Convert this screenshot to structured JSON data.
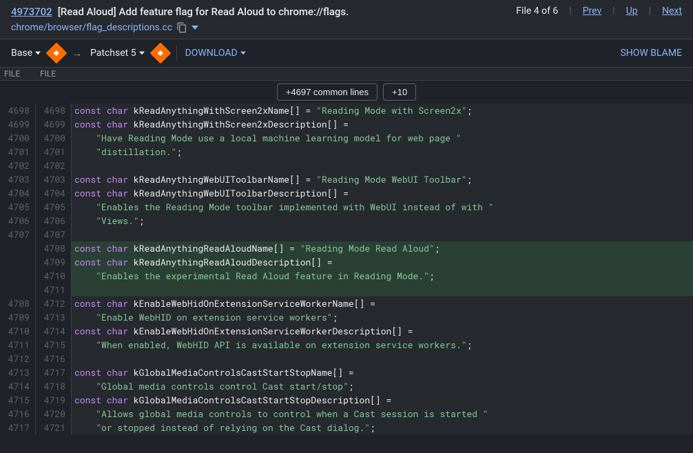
{
  "header": {
    "change_id": "4973702",
    "change_title": "[Read Aloud] Add feature flag for Read Aloud to chrome://flags.",
    "file_path": "chrome/browser/flag_descriptions.cc",
    "file_count": "File 4 of 6",
    "prev": "Prev",
    "up": "Up",
    "next": "Next"
  },
  "toolbar": {
    "base": "Base",
    "patchset": "Patchset 5",
    "download": "DOWNLOAD",
    "blame": "SHOW BLAME"
  },
  "file_headers": {
    "left": "FILE",
    "right": "FILE"
  },
  "context": {
    "common": "+4697 common lines",
    "expand": "+10"
  },
  "lines": [
    {
      "l": "4698",
      "r": "4698",
      "added": false,
      "tokens": [
        {
          "t": "kw",
          "v": "const"
        },
        {
          "t": "sp",
          "v": " "
        },
        {
          "t": "type",
          "v": "char"
        },
        {
          "t": "sp",
          "v": " "
        },
        {
          "t": "ident",
          "v": "kReadAnythingWithScreen2xName[] = "
        },
        {
          "t": "str",
          "v": "\"Reading Mode with Screen2x\""
        },
        {
          "t": "punct",
          "v": ";"
        }
      ]
    },
    {
      "l": "4699",
      "r": "4699",
      "added": false,
      "tokens": [
        {
          "t": "kw",
          "v": "const"
        },
        {
          "t": "sp",
          "v": " "
        },
        {
          "t": "type",
          "v": "char"
        },
        {
          "t": "sp",
          "v": " "
        },
        {
          "t": "ident",
          "v": "kReadAnythingWithScreen2xDescription[] ="
        }
      ]
    },
    {
      "l": "4700",
      "r": "4700",
      "added": false,
      "tokens": [
        {
          "t": "sp",
          "v": "    "
        },
        {
          "t": "str",
          "v": "\"Have Reading Mode use a local machine learning model for web page \""
        }
      ]
    },
    {
      "l": "4701",
      "r": "4701",
      "added": false,
      "tokens": [
        {
          "t": "sp",
          "v": "    "
        },
        {
          "t": "str",
          "v": "\"distillation.\""
        },
        {
          "t": "punct",
          "v": ";"
        }
      ]
    },
    {
      "l": "4702",
      "r": "4702",
      "added": false,
      "tokens": []
    },
    {
      "l": "4703",
      "r": "4703",
      "added": false,
      "tokens": [
        {
          "t": "kw",
          "v": "const"
        },
        {
          "t": "sp",
          "v": " "
        },
        {
          "t": "type",
          "v": "char"
        },
        {
          "t": "sp",
          "v": " "
        },
        {
          "t": "ident",
          "v": "kReadAnythingWebUIToolbarName[] = "
        },
        {
          "t": "str",
          "v": "\"Reading Mode WebUI Toolbar\""
        },
        {
          "t": "punct",
          "v": ";"
        }
      ]
    },
    {
      "l": "4704",
      "r": "4704",
      "added": false,
      "tokens": [
        {
          "t": "kw",
          "v": "const"
        },
        {
          "t": "sp",
          "v": " "
        },
        {
          "t": "type",
          "v": "char"
        },
        {
          "t": "sp",
          "v": " "
        },
        {
          "t": "ident",
          "v": "kReadAnythingWebUIToolbarDescription[] ="
        }
      ]
    },
    {
      "l": "4705",
      "r": "4705",
      "added": false,
      "tokens": [
        {
          "t": "sp",
          "v": "    "
        },
        {
          "t": "str",
          "v": "\"Enables the Reading Mode toolbar implemented with WebUI instead of with \""
        }
      ]
    },
    {
      "l": "4706",
      "r": "4706",
      "added": false,
      "tokens": [
        {
          "t": "sp",
          "v": "    "
        },
        {
          "t": "str",
          "v": "\"Views.\""
        },
        {
          "t": "punct",
          "v": ";"
        }
      ]
    },
    {
      "l": "4707",
      "r": "4707",
      "added": false,
      "tokens": []
    },
    {
      "l": "",
      "r": "4708",
      "added": true,
      "tokens": [
        {
          "t": "kw",
          "v": "const"
        },
        {
          "t": "sp",
          "v": " "
        },
        {
          "t": "type",
          "v": "char"
        },
        {
          "t": "sp",
          "v": " "
        },
        {
          "t": "ident",
          "v": "kReadAnythingReadAloudName[] = "
        },
        {
          "t": "str",
          "v": "\"Reading Mode Read Aloud\""
        },
        {
          "t": "punct",
          "v": ";"
        }
      ]
    },
    {
      "l": "",
      "r": "4709",
      "added": true,
      "tokens": [
        {
          "t": "kw",
          "v": "const"
        },
        {
          "t": "sp",
          "v": " "
        },
        {
          "t": "type",
          "v": "char"
        },
        {
          "t": "sp",
          "v": " "
        },
        {
          "t": "ident",
          "v": "kReadAnythingReadAloudDescription[] ="
        }
      ]
    },
    {
      "l": "",
      "r": "4710",
      "added": true,
      "tokens": [
        {
          "t": "sp",
          "v": "    "
        },
        {
          "t": "str",
          "v": "\"Enables the experimental Read Aloud feature in Reading Mode.\""
        },
        {
          "t": "punct",
          "v": ";"
        }
      ]
    },
    {
      "l": "",
      "r": "4711",
      "added": true,
      "tokens": []
    },
    {
      "l": "4708",
      "r": "4712",
      "added": false,
      "tokens": [
        {
          "t": "kw",
          "v": "const"
        },
        {
          "t": "sp",
          "v": " "
        },
        {
          "t": "type",
          "v": "char"
        },
        {
          "t": "sp",
          "v": " "
        },
        {
          "t": "ident",
          "v": "kEnableWebHidOnExtensionServiceWorkerName[] ="
        }
      ]
    },
    {
      "l": "4709",
      "r": "4713",
      "added": false,
      "tokens": [
        {
          "t": "sp",
          "v": "    "
        },
        {
          "t": "str",
          "v": "\"Enable WebHID on extension service workers\""
        },
        {
          "t": "punct",
          "v": ";"
        }
      ]
    },
    {
      "l": "4710",
      "r": "4714",
      "added": false,
      "tokens": [
        {
          "t": "kw",
          "v": "const"
        },
        {
          "t": "sp",
          "v": " "
        },
        {
          "t": "type",
          "v": "char"
        },
        {
          "t": "sp",
          "v": " "
        },
        {
          "t": "ident",
          "v": "kEnableWebHidOnExtensionServiceWorkerDescription[] ="
        }
      ]
    },
    {
      "l": "4711",
      "r": "4715",
      "added": false,
      "tokens": [
        {
          "t": "sp",
          "v": "    "
        },
        {
          "t": "str",
          "v": "\"When enabled, WebHID API is available on extension service workers.\""
        },
        {
          "t": "punct",
          "v": ";"
        }
      ]
    },
    {
      "l": "4712",
      "r": "4716",
      "added": false,
      "tokens": []
    },
    {
      "l": "4713",
      "r": "4717",
      "added": false,
      "tokens": [
        {
          "t": "kw",
          "v": "const"
        },
        {
          "t": "sp",
          "v": " "
        },
        {
          "t": "type",
          "v": "char"
        },
        {
          "t": "sp",
          "v": " "
        },
        {
          "t": "ident",
          "v": "kGlobalMediaControlsCastStartStopName[] ="
        }
      ]
    },
    {
      "l": "4714",
      "r": "4718",
      "added": false,
      "tokens": [
        {
          "t": "sp",
          "v": "    "
        },
        {
          "t": "str",
          "v": "\"Global media controls control Cast start/stop\""
        },
        {
          "t": "punct",
          "v": ";"
        }
      ]
    },
    {
      "l": "4715",
      "r": "4719",
      "added": false,
      "tokens": [
        {
          "t": "kw",
          "v": "const"
        },
        {
          "t": "sp",
          "v": " "
        },
        {
          "t": "type",
          "v": "char"
        },
        {
          "t": "sp",
          "v": " "
        },
        {
          "t": "ident",
          "v": "kGlobalMediaControlsCastStartStopDescription[] ="
        }
      ]
    },
    {
      "l": "4716",
      "r": "4720",
      "added": false,
      "tokens": [
        {
          "t": "sp",
          "v": "    "
        },
        {
          "t": "str",
          "v": "\"Allows global media controls to control when a Cast session is started \""
        }
      ]
    },
    {
      "l": "4717",
      "r": "4721",
      "added": false,
      "tokens": [
        {
          "t": "sp",
          "v": "    "
        },
        {
          "t": "str",
          "v": "\"or stopped instead of relying on the Cast dialog.\""
        },
        {
          "t": "punct",
          "v": ";"
        }
      ]
    }
  ]
}
